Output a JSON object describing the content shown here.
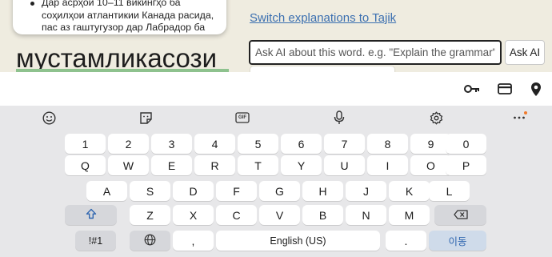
{
  "definition_card": {
    "lines": [
      "Дар асрҳои 10–11 викингҳо ба",
      "соҳилҳои атлантикии Канада расида,",
      "пас аз гаштугузор дар Лабрадор ба"
    ]
  },
  "headword": "мустамликасози",
  "switch_link": "Switch explanations to Tajik",
  "ask": {
    "placeholder": "Ask AI about this word. e.g. \"Explain the grammar\"",
    "button_label": "Ask AI"
  },
  "autofill_icons": [
    "key-icon",
    "credit-card-icon",
    "location-pin-icon"
  ],
  "keyboard": {
    "toolbar": [
      "emoji-icon",
      "sticker-icon",
      "gif-icon",
      "microphone-icon",
      "settings-icon",
      "more-options-icon"
    ],
    "gif_label": "GIF",
    "row_numbers": [
      "1",
      "2",
      "3",
      "4",
      "5",
      "6",
      "7",
      "8",
      "9",
      "0"
    ],
    "row_q": [
      "Q",
      "W",
      "E",
      "R",
      "T",
      "Y",
      "U",
      "I",
      "O",
      "P"
    ],
    "row_a": [
      "A",
      "S",
      "D",
      "F",
      "G",
      "H",
      "J",
      "K",
      "L"
    ],
    "row_z": [
      "Z",
      "X",
      "C",
      "V",
      "B",
      "N",
      "M"
    ],
    "symbols_label": "!#1",
    "comma": ",",
    "space_label": "English (US)",
    "period": ".",
    "action_label": "이동",
    "accent_color": "#2f66b0"
  }
}
